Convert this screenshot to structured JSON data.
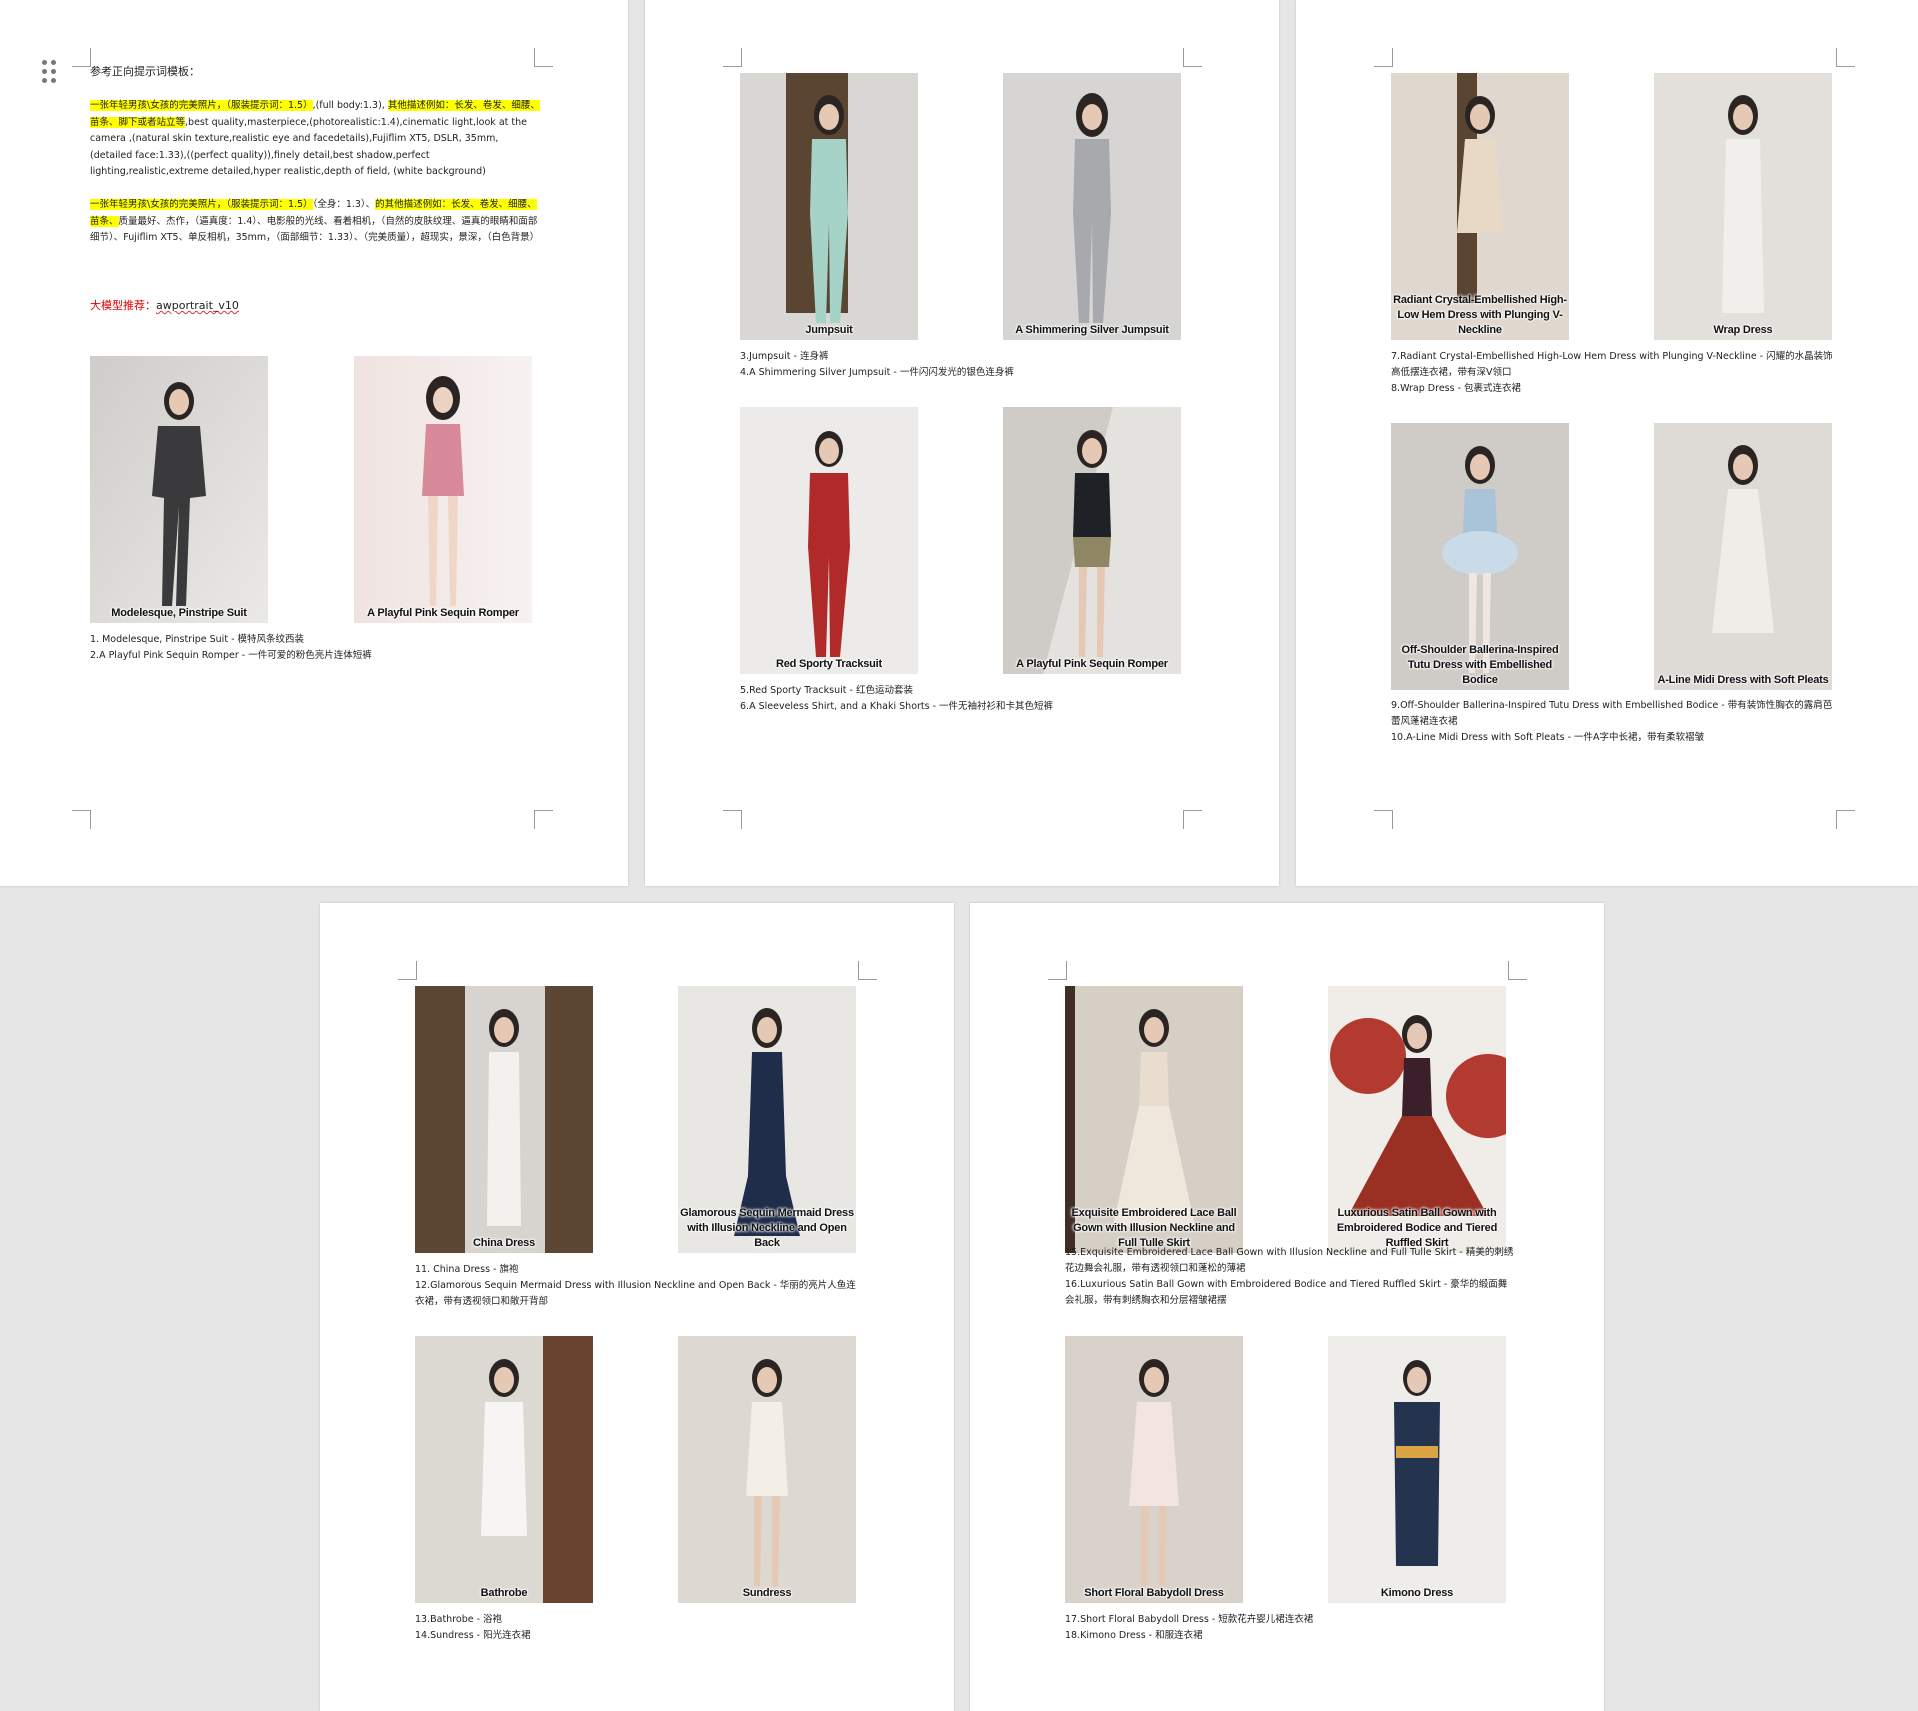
{
  "page1": {
    "heading": "参考正向提示词模板：",
    "prompt_en": {
      "hl_a": "一张年轻男孩\\女孩的完美照片，（服装提示词：1.5）",
      "plain_a": ",(full body:1.3), ",
      "hl_b": "其他描述例如：长发、卷发、细腰、苗条、脚下或者站立等",
      "plain_b": ",best quality,masterpiece,(photorealistic:1.4),cinematic light,look at the camera ,(natural skin texture,realistic eye and facedetails),Fujiflim XT5, DSLR, 35mm,(detailed face:1.33),((perfect quality)),finely detail,best shadow,perfect lighting,realistic,extreme detailed,hyper realistic,depth of field, (white background)"
    },
    "prompt_cn": {
      "hl_a": "一张年轻男孩\\女孩的完美照片，（服装提示词：1.5）",
      "plain_a": "（全身：1.3）、",
      "hl_b": "的其他描述例如：长发、卷发、细腰、苗条、",
      "plain_b": "质量最好、杰作，（逼真度：1.4）、电影般的光线、看着相机，（自然的皮肤纹理、逼真的眼睛和面部细节）、Fujiflim XT5、单反相机，35mm，（面部细节：1.33）、（完美质量），超现实，景深，（白色背景）"
    },
    "model_label": "大模型推荐：",
    "model_name": "awportrait_v10",
    "photos": [
      {
        "caption": "Modelesque, Pinstripe Suit"
      },
      {
        "caption": "A Playful Pink Sequin Romper"
      }
    ],
    "desc": [
      "1. Modelesque, Pinstripe Suit - 模特风条纹西装",
      "2.A Playful Pink Sequin Romper - 一件可爱的粉色亮片连体短裤"
    ]
  },
  "page2": {
    "photos": [
      {
        "caption": "Jumpsuit"
      },
      {
        "caption": "A Shimmering Silver Jumpsuit"
      },
      {
        "caption": "Red Sporty Tracksuit"
      },
      {
        "caption": "A Playful Pink Sequin Romper"
      }
    ],
    "desc_top": [
      "3.Jumpsuit - 连身裤",
      "4.A Shimmering Silver Jumpsuit - 一件闪闪发光的银色连身裤"
    ],
    "desc_bottom": [
      "5.Red Sporty Tracksuit - 红色运动套装",
      "6.A Sleeveless Shirt, and a Khaki Shorts - 一件无袖衬衫和卡其色短裤"
    ]
  },
  "page3": {
    "photos": [
      {
        "caption": "Radiant Crystal-Embellished High-Low Hem Dress with Plunging V-Neckline"
      },
      {
        "caption": "Wrap Dress"
      },
      {
        "caption": "Off-Shoulder Ballerina-Inspired Tutu Dress with Embellished Bodice"
      },
      {
        "caption": "A-Line Midi Dress with Soft Pleats"
      }
    ],
    "desc_top": [
      "7.Radiant Crystal-Embellished High-Low Hem Dress with Plunging V-Neckline - 闪耀的水晶装饰高低摆连衣裙，带有深V领口",
      "8.Wrap Dress - 包裹式连衣裙"
    ],
    "desc_bottom": [
      "9.Off-Shoulder Ballerina-Inspired Tutu Dress with Embellished Bodice - 带有装饰性胸衣的露肩芭蕾风蓬裙连衣裙",
      "10.A-Line Midi Dress with Soft Pleats - 一件A字中长裙，带有柔软褶皱"
    ]
  },
  "page4": {
    "photos": [
      {
        "caption": "China Dress"
      },
      {
        "caption": "Glamorous Sequin Mermaid Dress with Illusion Neckline and Open Back"
      },
      {
        "caption": "Bathrobe"
      },
      {
        "caption": "Sundress"
      }
    ],
    "desc_top": [
      "11. China Dress - 旗袍",
      "12.Glamorous Sequin Mermaid Dress with Illusion Neckline and Open Back - 华丽的亮片人鱼连衣裙，带有透视领口和敞开背部"
    ],
    "desc_bottom": [
      "13.Bathrobe - 浴袍",
      "14.Sundress - 阳光连衣裙"
    ]
  },
  "page5": {
    "photos": [
      {
        "caption": "Exquisite Embroidered Lace Ball Gown with Illusion Neckline and Full Tulle Skirt"
      },
      {
        "caption": "Luxurious Satin Ball Gown with Embroidered Bodice and Tiered Ruffled Skirt"
      },
      {
        "caption": "Short Floral Babydoll Dress"
      },
      {
        "caption": "Kimono Dress"
      }
    ],
    "desc_top": [
      "15.Exquisite Embroidered Lace Ball Gown with Illusion Neckline and Full Tulle Skirt - 精美的刺绣花边舞会礼服，带有透视领口和蓬松的薄裙",
      "16.Luxurious Satin Ball Gown with Embroidered Bodice and Tiered Ruffled Skirt - 豪华的缎面舞会礼服，带有刺绣胸衣和分层褶皱裙摆"
    ],
    "desc_bottom": [
      "17.Short Floral Babydoll Dress - 短款花卉婴儿裙连衣裙",
      "18.Kimono Dress - 和服连衣裙"
    ]
  },
  "colors": {
    "heading_red": "#e00000",
    "highlight": "#ffff00",
    "page_bg": "#ffffff",
    "canvas_bg": "#e6e6e6"
  },
  "icons": {
    "drag_handle": "grip-dots-icon"
  }
}
